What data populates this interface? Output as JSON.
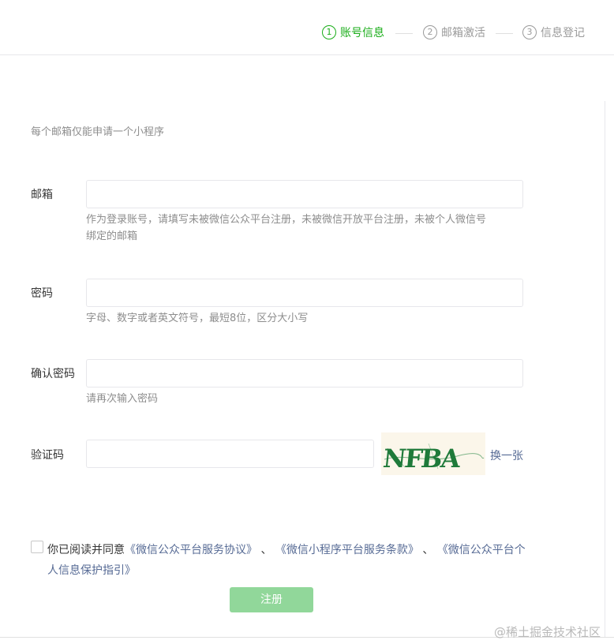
{
  "steps": [
    {
      "num": "1",
      "label": "账号信息",
      "active": true
    },
    {
      "num": "2",
      "label": "邮箱激活",
      "active": false
    },
    {
      "num": "3",
      "label": "信息登记",
      "active": false
    }
  ],
  "tip": "每个邮箱仅能申请一个小程序",
  "form": {
    "email": {
      "label": "邮箱",
      "value": "",
      "hint": [
        "作为登录账号，请填写未被微信公众平台注册，未被微信开放平台注册，未被个人微信号",
        "绑定的邮箱"
      ]
    },
    "password": {
      "label": "密码",
      "value": "",
      "hint": "字母、数字或者英文符号，最短8位，区分大小写"
    },
    "confirm": {
      "label": "确认密码",
      "value": "",
      "hint": "请再次输入密码"
    },
    "captcha": {
      "label": "验证码",
      "value": "",
      "image_text": "NFBA",
      "refresh": "换一张"
    }
  },
  "agreement": {
    "checked": false,
    "prefix": "你已阅读并同意",
    "link1": "《微信公众平台服务协议》",
    "sep1": "、",
    "link2": "《微信小程序平台服务条款》",
    "sep2": "、",
    "link3": "《微信公众平台个人信息保护指引》"
  },
  "submit_label": "注册",
  "watermark": "@稀土掘金技术社区",
  "colors": {
    "accent": "#1aad19",
    "link": "#576b95",
    "button_disabled": "#91d79a",
    "captcha_text": "#1f7a3a"
  }
}
